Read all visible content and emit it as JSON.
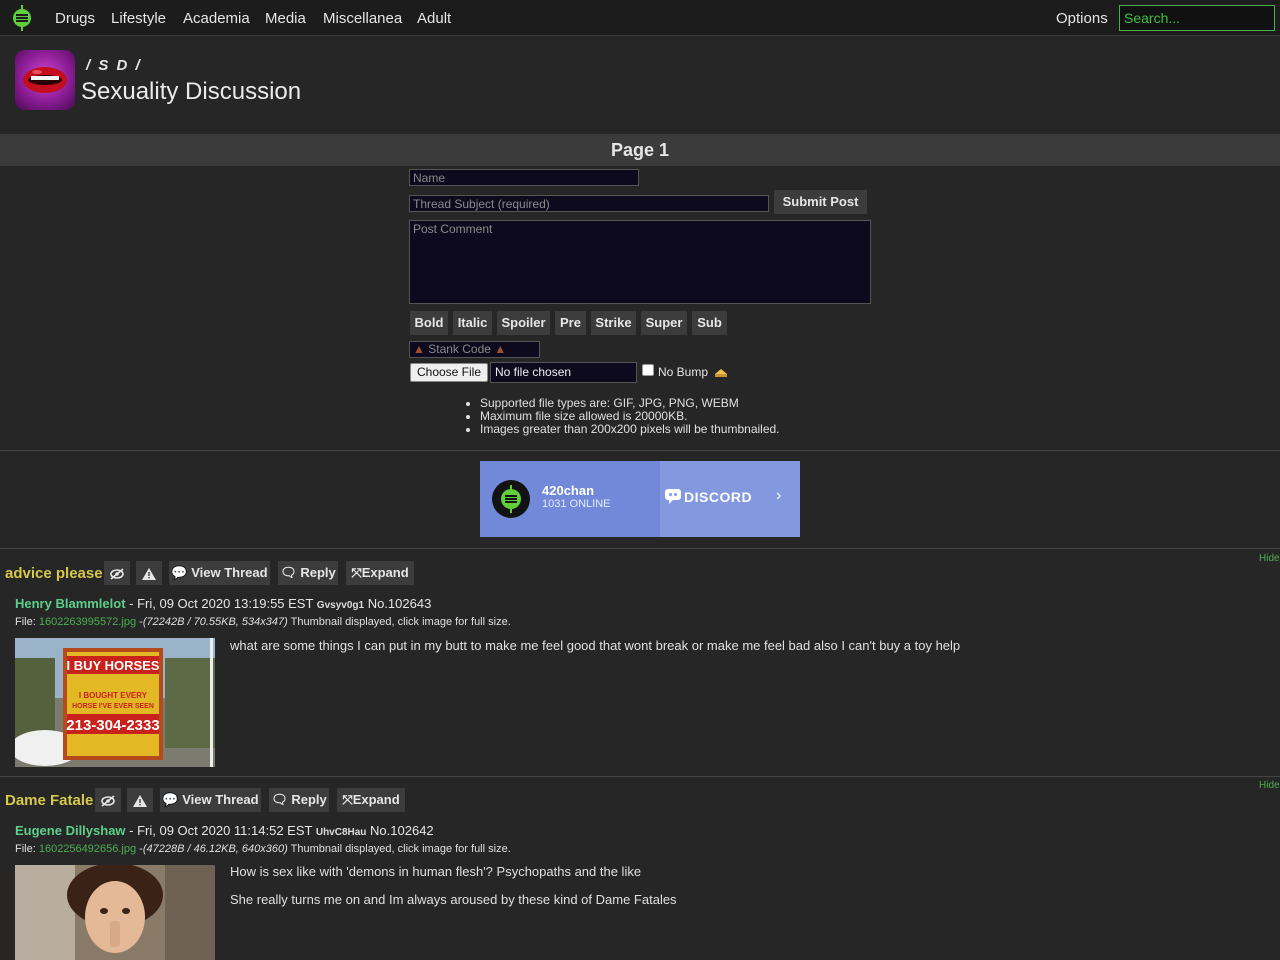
{
  "nav": {
    "items": [
      "Drugs",
      "Lifestyle",
      "Academia",
      "Media",
      "Miscellanea",
      "Adult"
    ],
    "options": "Options",
    "search_placeholder": "Search..."
  },
  "board": {
    "code": "/ S D /",
    "title": "Sexuality Discussion"
  },
  "page_label": "Page 1",
  "form": {
    "name_placeholder": "Name",
    "subject_placeholder": "Thread Subject (required)",
    "submit": "Submit Post",
    "comment_placeholder": "Post Comment",
    "format_buttons": [
      "Bold",
      "Italic",
      "Spoiler",
      "Pre",
      "Strike",
      "Super",
      "Sub"
    ],
    "stank_placeholder": "Stank Code",
    "choose_file": "Choose File",
    "no_file": "No file chosen",
    "no_bump": "No Bump",
    "rules": [
      "Supported file types are: GIF, JPG, PNG, WEBM",
      "Maximum file size allowed is 20000KB.",
      "Images greater than 200x200 pixels will be thumbnailed."
    ]
  },
  "discord": {
    "server": "420chan",
    "online": "1031 ONLINE",
    "brand": "DISCORD"
  },
  "threads": [
    {
      "hide": "Hide",
      "subject": "advice please",
      "view_thread": "View Thread",
      "reply": "Reply",
      "expand": "Expand",
      "name": "Henry Blammlelot",
      "date": " - Fri, 09 Oct 2020 13:19:55 EST ",
      "uid": "Gvsyv0g1",
      "no": "No.102643",
      "file_prefix": "File: ",
      "file_name": "1602263995572.jpg",
      "file_meta": "(72242B / 70.55KB, 534x347)",
      "file_note": " Thumbnail displayed, click image for full size.",
      "thumb_text": [
        "I BUY HORSES",
        "I BOUGHT EVERY",
        "HORSE I'VE EVER SEEN",
        "213-304-2333"
      ],
      "comment": [
        "what are some things I can put in my butt to make me feel good that wont break or make me feel bad also I can't buy a toy help"
      ]
    },
    {
      "hide": "Hide",
      "subject": "Dame Fatale",
      "view_thread": "View Thread",
      "reply": "Reply",
      "expand": "Expand",
      "name": "Eugene Dillyshaw",
      "date": " - Fri, 09 Oct 2020 11:14:52 EST ",
      "uid": "UhvC8Hau",
      "no": "No.102642",
      "file_prefix": "File: ",
      "file_name": "1602256492656.jpg",
      "file_meta": "(47228B / 46.12KB, 640x360)",
      "file_note": " Thumbnail displayed, click image for full size.",
      "comment": [
        "How is sex like with 'demons in human flesh'? Psychopaths and the like",
        "She really turns me on and Im always aroused by these kind of Dame Fatales"
      ]
    }
  ],
  "colors": {
    "accent_green": "#4caf50",
    "subject_yellow": "#d6c84a",
    "poster_green": "#5dcf8a",
    "discord": "#7289da"
  }
}
